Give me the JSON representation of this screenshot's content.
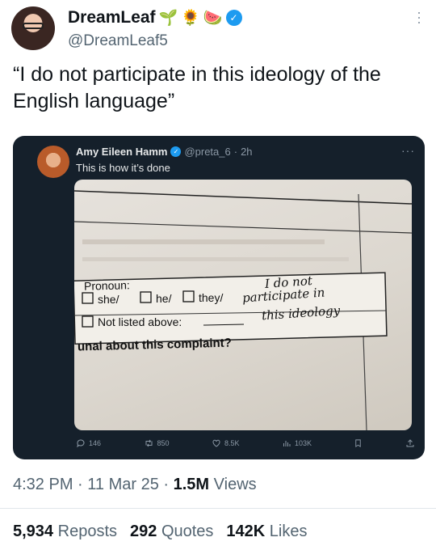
{
  "outer_tweet": {
    "author_name": "DreamLeaf",
    "name_emojis": [
      "🌱",
      "🌻",
      "🍉"
    ],
    "handle": "@DreamLeaf5",
    "text": "“I do not participate in this ideology of the English language”",
    "time": "4:32 PM",
    "date": "11 Mar 25",
    "views_count": "1.5M",
    "views_label": "Views",
    "reposts_count": "5,934",
    "reposts_label": "Reposts",
    "quotes_count": "292",
    "quotes_label": "Quotes",
    "likes_count": "142K",
    "likes_label": "Likes"
  },
  "quoted_tweet": {
    "author_name": "Amy Eileen Hamm",
    "handle": "@preta_6",
    "age": "2h",
    "text": "This is how it’s done",
    "photo": {
      "pronoun_label": "Pronoun:",
      "options": [
        "she/",
        "he/",
        "they/"
      ],
      "not_listed": "Not listed above:",
      "handwritten_line1": "I do not",
      "handwritten_line2": "participate in",
      "handwritten_line3": "this ideology",
      "complaint_text": "unal about this complaint?"
    },
    "actions": {
      "replies": "146",
      "reposts": "850",
      "likes": "8.5K",
      "views": "103K"
    }
  },
  "colors": {
    "verified_blue": "#1d9bf0",
    "card_background": "#15202b",
    "muted_text": "#536471"
  },
  "icons": [
    "verified-badge-icon",
    "more-options-icon",
    "reply-icon",
    "repost-icon",
    "like-icon",
    "views-icon",
    "bookmark-icon",
    "share-icon"
  ]
}
